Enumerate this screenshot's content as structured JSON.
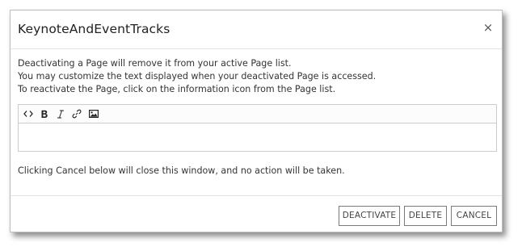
{
  "dialog": {
    "title": "KeynoteAndEventTracks",
    "close_label": "×",
    "body_lines": [
      "Deactivating a Page will remove it from your active Page list.",
      "You may customize the text displayed when your deactivated Page is accessed.",
      "To reactivate the Page, click on the information icon from the Page list."
    ],
    "editor": {
      "toolbar": [
        {
          "name": "code-view-icon",
          "icon": "code"
        },
        {
          "name": "bold-icon",
          "icon": "bold"
        },
        {
          "name": "italic-icon",
          "icon": "italic"
        },
        {
          "name": "link-icon",
          "icon": "link"
        },
        {
          "name": "image-icon",
          "icon": "image"
        }
      ],
      "value": ""
    },
    "footer_note": "Clicking Cancel below will close this window, and no action will be taken.",
    "buttons": {
      "deactivate": "DEACTIVATE",
      "delete": "DELETE",
      "cancel": "CANCEL"
    }
  }
}
